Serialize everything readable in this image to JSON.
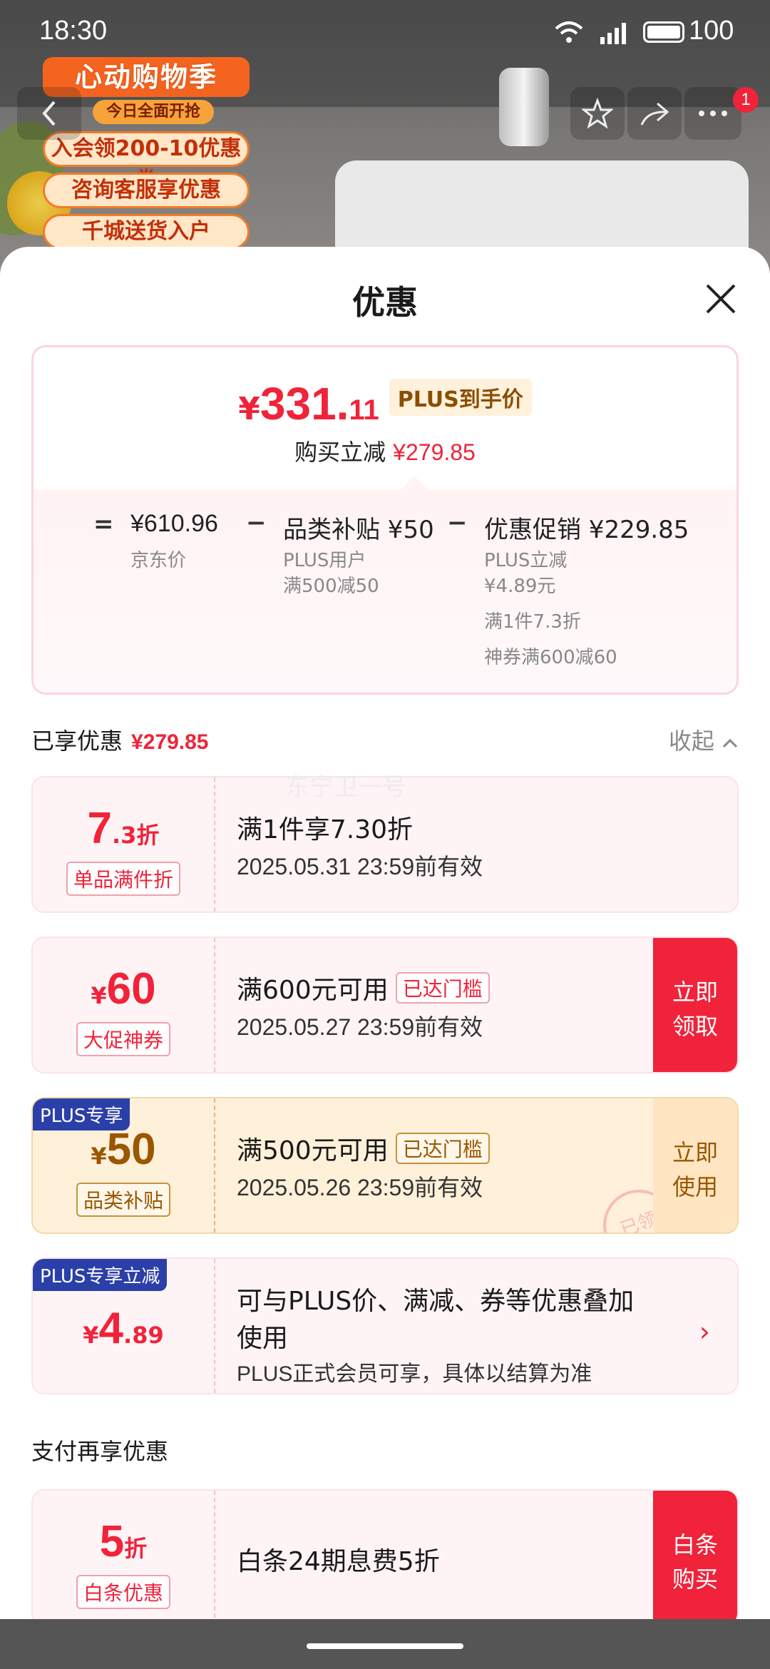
{
  "status_bar": {
    "time": "18:30",
    "battery": "100"
  },
  "background_promo": {
    "title": "心动购物季",
    "subtitle": "今日全面开抢",
    "lines": [
      "入会领200-10优惠券",
      "咨询客服享优惠",
      "千城送货入户"
    ]
  },
  "top_nav": {
    "cart_badge": "1"
  },
  "sheet": {
    "title": "优惠",
    "price": {
      "yen": "¥",
      "integer": "331.",
      "decimal": "11",
      "tag": "PLUS到手价",
      "reduce_label": "购买立减",
      "reduce_amount": "¥279.85"
    },
    "breakdown": {
      "equals": "=",
      "minus": "−",
      "jd_price": "¥610.96",
      "jd_price_label": "京东价",
      "category_subsidy": "品类补贴 ¥50",
      "category_sub1": "PLUS用户",
      "category_sub2": "满500减50",
      "promo": "优惠促销 ¥229.85",
      "promo_sub1": "PLUS立减",
      "promo_sub2": "¥4.89元",
      "promo_sub3": "满1件7.3折",
      "promo_sub4": "神券满600减60"
    },
    "enjoyed": {
      "label": "已享优惠",
      "amount": "¥279.85",
      "collapse": "收起"
    },
    "watermark": "东宁卫一号",
    "coupons": [
      {
        "big1": "7",
        "big2": ".3折",
        "tag": "单品满件折",
        "line1": "满1件享7.30折",
        "line2": "2025.05.31 23:59前有效"
      },
      {
        "big1_yen": "¥",
        "big1": "60",
        "tag": "大促神券",
        "line1": "满600元可用",
        "reached": "已达门槛",
        "line2": "2025.05.27 23:59前有效",
        "action": "立即领取"
      },
      {
        "corner": "PLUS专享",
        "big1_yen": "¥",
        "big1": "50",
        "tag": "品类补贴",
        "line1": "满500元可用",
        "reached": "已达门槛",
        "line2": "2025.05.26 23:59前有效",
        "action": "立即使用",
        "stamp": "已领"
      },
      {
        "corner": "PLUS专享立减",
        "big1_yen": "¥",
        "big1": "4",
        "big2": ".89",
        "line1a": "可与PLUS价、满减、券等优惠叠加",
        "line1b": "使用",
        "line2": "PLUS正式会员可享，具体以结算为准"
      }
    ],
    "pay_section": {
      "title": "支付再享优惠",
      "coupon": {
        "big1": "5",
        "big2": "折",
        "tag": "白条优惠",
        "line1": "白条24期息费5折",
        "action": "白条购买"
      }
    }
  },
  "colors": {
    "accent_red": "#f0233a",
    "plus_gold": "#9a5700",
    "plus_blue": "#2b3fa8"
  }
}
